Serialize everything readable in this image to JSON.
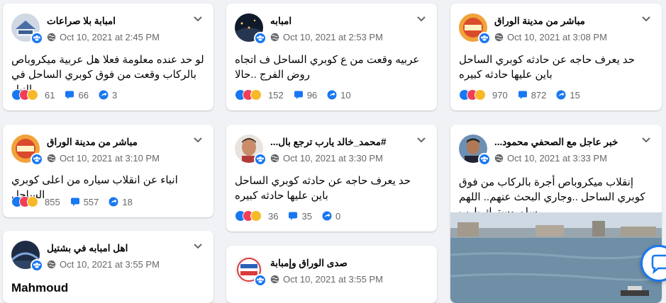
{
  "colors": {
    "background": "#f0f2f5",
    "card": "#ffffff",
    "secondary_text": "#65676b",
    "brand_blue": "#1877f2"
  },
  "posts": [
    {
      "author": "امبابة بلا صراعات",
      "date": "Oct 10, 2021 at 2:45 PM",
      "text": "لو حد عنده معلومة فعلا هل عربية ميكروباص بالركاب وقعت من فوق كوبري الساحل في النيل",
      "reactions": "61",
      "comments": "66",
      "shares": "3"
    },
    {
      "author": "امبابه",
      "date": "Oct 10, 2021 at 2:53 PM",
      "text": "عربيه وقعت من ع كوبري الساحل ف اتجاه روض الفرج ..حالا",
      "reactions": "152",
      "comments": "96",
      "shares": "10"
    },
    {
      "author": "مباشر من مدينة الوراق",
      "date": "Oct 10, 2021 at 3:08 PM",
      "text": "حد يعرف حاجه عن حادثه كوبري الساحل باين عليها حادثه كبيره",
      "reactions": "970",
      "comments": "872",
      "shares": "15"
    },
    {
      "author": "مباشر من مدينة الوراق",
      "date": "Oct 10, 2021 at 3:10 PM",
      "text": "انباء عن انقلاب سياره من اعلى كوبري الساحل",
      "reactions": "855",
      "comments": "557",
      "shares": "18"
    },
    {
      "author": "#محمد_خالد يارب ترجع بال...",
      "date": "Oct 10, 2021 at 3:30 PM",
      "text": "حد يعرف حاجه عن حادثه كوبري الساحل باين عليها حادثه كبيره",
      "reactions": "36",
      "comments": "35",
      "shares": "0"
    },
    {
      "author": "خبر عاجل مع الصحفي محمود...",
      "date": "Oct 10, 2021 at 3:33 PM",
      "text": "إنقلاب ميكروباص أجرة بالركاب من فوق كوبري الساحل ..وجاري البحث عنهم.. اللهم سلم وسترك يارب"
    },
    {
      "author": "اهل امبابه في بشتيل",
      "date": "Oct 10, 2021 at 3:55 PM",
      "shared_name": "Mahmoud"
    },
    {
      "author": "صدى الوراق وإمبابة",
      "date": "Oct 10, 2021 at 3:55 PM"
    }
  ],
  "icons": {
    "globe": "globe-icon",
    "chevron": "chevron-down-icon",
    "comment": "comment-icon",
    "share": "share-icon",
    "group": "group-icon"
  }
}
